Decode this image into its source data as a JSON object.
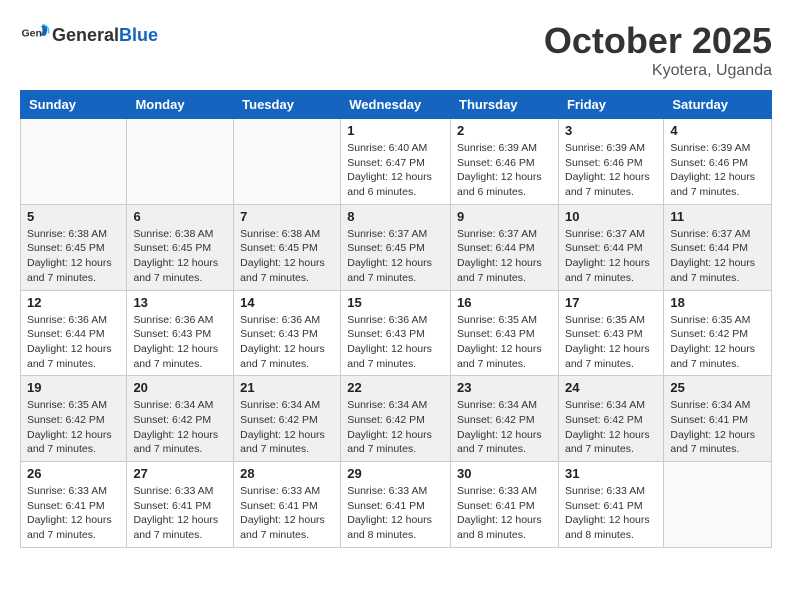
{
  "header": {
    "logo_general": "General",
    "logo_blue": "Blue",
    "month": "October 2025",
    "location": "Kyotera, Uganda"
  },
  "days_of_week": [
    "Sunday",
    "Monday",
    "Tuesday",
    "Wednesday",
    "Thursday",
    "Friday",
    "Saturday"
  ],
  "weeks": [
    [
      {
        "day": "",
        "info": ""
      },
      {
        "day": "",
        "info": ""
      },
      {
        "day": "",
        "info": ""
      },
      {
        "day": "1",
        "info": "Sunrise: 6:40 AM\nSunset: 6:47 PM\nDaylight: 12 hours and 6 minutes."
      },
      {
        "day": "2",
        "info": "Sunrise: 6:39 AM\nSunset: 6:46 PM\nDaylight: 12 hours and 6 minutes."
      },
      {
        "day": "3",
        "info": "Sunrise: 6:39 AM\nSunset: 6:46 PM\nDaylight: 12 hours and 7 minutes."
      },
      {
        "day": "4",
        "info": "Sunrise: 6:39 AM\nSunset: 6:46 PM\nDaylight: 12 hours and 7 minutes."
      }
    ],
    [
      {
        "day": "5",
        "info": "Sunrise: 6:38 AM\nSunset: 6:45 PM\nDaylight: 12 hours and 7 minutes."
      },
      {
        "day": "6",
        "info": "Sunrise: 6:38 AM\nSunset: 6:45 PM\nDaylight: 12 hours and 7 minutes."
      },
      {
        "day": "7",
        "info": "Sunrise: 6:38 AM\nSunset: 6:45 PM\nDaylight: 12 hours and 7 minutes."
      },
      {
        "day": "8",
        "info": "Sunrise: 6:37 AM\nSunset: 6:45 PM\nDaylight: 12 hours and 7 minutes."
      },
      {
        "day": "9",
        "info": "Sunrise: 6:37 AM\nSunset: 6:44 PM\nDaylight: 12 hours and 7 minutes."
      },
      {
        "day": "10",
        "info": "Sunrise: 6:37 AM\nSunset: 6:44 PM\nDaylight: 12 hours and 7 minutes."
      },
      {
        "day": "11",
        "info": "Sunrise: 6:37 AM\nSunset: 6:44 PM\nDaylight: 12 hours and 7 minutes."
      }
    ],
    [
      {
        "day": "12",
        "info": "Sunrise: 6:36 AM\nSunset: 6:44 PM\nDaylight: 12 hours and 7 minutes."
      },
      {
        "day": "13",
        "info": "Sunrise: 6:36 AM\nSunset: 6:43 PM\nDaylight: 12 hours and 7 minutes."
      },
      {
        "day": "14",
        "info": "Sunrise: 6:36 AM\nSunset: 6:43 PM\nDaylight: 12 hours and 7 minutes."
      },
      {
        "day": "15",
        "info": "Sunrise: 6:36 AM\nSunset: 6:43 PM\nDaylight: 12 hours and 7 minutes."
      },
      {
        "day": "16",
        "info": "Sunrise: 6:35 AM\nSunset: 6:43 PM\nDaylight: 12 hours and 7 minutes."
      },
      {
        "day": "17",
        "info": "Sunrise: 6:35 AM\nSunset: 6:43 PM\nDaylight: 12 hours and 7 minutes."
      },
      {
        "day": "18",
        "info": "Sunrise: 6:35 AM\nSunset: 6:42 PM\nDaylight: 12 hours and 7 minutes."
      }
    ],
    [
      {
        "day": "19",
        "info": "Sunrise: 6:35 AM\nSunset: 6:42 PM\nDaylight: 12 hours and 7 minutes."
      },
      {
        "day": "20",
        "info": "Sunrise: 6:34 AM\nSunset: 6:42 PM\nDaylight: 12 hours and 7 minutes."
      },
      {
        "day": "21",
        "info": "Sunrise: 6:34 AM\nSunset: 6:42 PM\nDaylight: 12 hours and 7 minutes."
      },
      {
        "day": "22",
        "info": "Sunrise: 6:34 AM\nSunset: 6:42 PM\nDaylight: 12 hours and 7 minutes."
      },
      {
        "day": "23",
        "info": "Sunrise: 6:34 AM\nSunset: 6:42 PM\nDaylight: 12 hours and 7 minutes."
      },
      {
        "day": "24",
        "info": "Sunrise: 6:34 AM\nSunset: 6:42 PM\nDaylight: 12 hours and 7 minutes."
      },
      {
        "day": "25",
        "info": "Sunrise: 6:34 AM\nSunset: 6:41 PM\nDaylight: 12 hours and 7 minutes."
      }
    ],
    [
      {
        "day": "26",
        "info": "Sunrise: 6:33 AM\nSunset: 6:41 PM\nDaylight: 12 hours and 7 minutes."
      },
      {
        "day": "27",
        "info": "Sunrise: 6:33 AM\nSunset: 6:41 PM\nDaylight: 12 hours and 7 minutes."
      },
      {
        "day": "28",
        "info": "Sunrise: 6:33 AM\nSunset: 6:41 PM\nDaylight: 12 hours and 7 minutes."
      },
      {
        "day": "29",
        "info": "Sunrise: 6:33 AM\nSunset: 6:41 PM\nDaylight: 12 hours and 8 minutes."
      },
      {
        "day": "30",
        "info": "Sunrise: 6:33 AM\nSunset: 6:41 PM\nDaylight: 12 hours and 8 minutes."
      },
      {
        "day": "31",
        "info": "Sunrise: 6:33 AM\nSunset: 6:41 PM\nDaylight: 12 hours and 8 minutes."
      },
      {
        "day": "",
        "info": ""
      }
    ]
  ]
}
